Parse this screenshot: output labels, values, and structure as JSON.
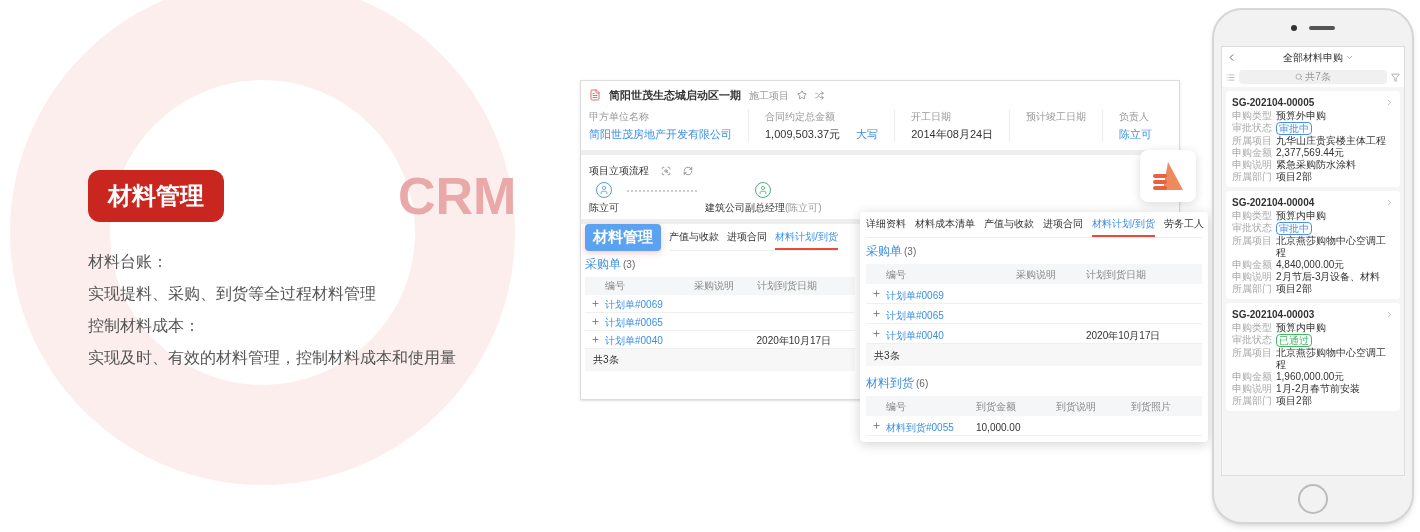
{
  "feature": {
    "watermark": "CRM",
    "title": "材料管理",
    "lines": [
      "材料台账：",
      "实现提料、采购、到货等全过程材料管理",
      "控制材料成本：",
      "实现及时、有效的材料管理，控制材料成本和使用量"
    ]
  },
  "project_window": {
    "title": "简阳世茂生态城启动区一期",
    "tag": "施工项目",
    "fields": [
      {
        "label": "甲方单位名称",
        "value": "简阳世茂房地产开发有限公司",
        "link": true
      },
      {
        "label": "合同约定总金额",
        "value": "1,009,503.37元",
        "link": false,
        "extra": "大写"
      },
      {
        "label": "开工日期",
        "value": "2014年08月24日",
        "link": false
      },
      {
        "label": "预计竣工日期"
      },
      {
        "label": "负责人",
        "value": "陈立可",
        "link": true
      }
    ],
    "process": {
      "title": "项目立项流程",
      "steps": [
        {
          "name": "陈立可",
          "color": "#5b9bd5"
        },
        {
          "name": "建筑公司副总经理",
          "note": "(陈立可)",
          "color": "#4caf7a"
        }
      ]
    },
    "badge": "材料管理",
    "tabs": [
      {
        "label": "产值与收款",
        "selected": false
      },
      {
        "label": "进项合同",
        "selected": false
      },
      {
        "label": "材料计划/到货",
        "selected": true
      }
    ],
    "table": {
      "title": "采购单",
      "count": "(3)",
      "columns": [
        "编号",
        "采购说明",
        "计划到货日期"
      ],
      "rows": [
        {
          "number": "计划单#0069"
        },
        {
          "number": "计划单#0065"
        },
        {
          "number": "计划单#0040",
          "date": "2020年10月17日"
        }
      ],
      "footer": "共3条"
    }
  },
  "detail_card": {
    "tabs": [
      {
        "label": "详细资料",
        "selected": false
      },
      {
        "label": "材料成本清单",
        "selected": false
      },
      {
        "label": "产值与收款",
        "selected": false
      },
      {
        "label": "进项合同",
        "selected": false
      },
      {
        "label": "材料计划/到货",
        "selected": true
      },
      {
        "label": "劳务工人",
        "selected": false
      }
    ],
    "purchase": {
      "title": "采购单",
      "count": "(3)",
      "columns": [
        "编号",
        "采购说明",
        "计划到货日期"
      ],
      "rows": [
        {
          "number": "计划单#0069"
        },
        {
          "number": "计划单#0065"
        },
        {
          "number": "计划单#0040",
          "date": "2020年10月17日"
        }
      ],
      "footer": "共3条"
    },
    "arrival": {
      "title": "材料到货",
      "count": "(6)",
      "columns": [
        "编号",
        "到货金额",
        "到货说明",
        "到货照片"
      ],
      "rows": [
        {
          "number": "材料到货#0055",
          "amount": "10,000.00"
        }
      ]
    }
  },
  "phone": {
    "title": "全部材料申购",
    "search": {
      "placeholder": "共7条"
    },
    "cards": [
      {
        "code": "SG-202104-00005",
        "fields": [
          {
            "label": "申购类型",
            "value": "预算外申购"
          },
          {
            "label": "审批状态",
            "value": "审批中",
            "kind": "status",
            "color": "#4a90e2"
          },
          {
            "label": "所属项目",
            "value": "九华山庄贵宾楼主体工程"
          },
          {
            "label": "申购金额",
            "value": "2,377,569.44元"
          },
          {
            "label": "申购说明",
            "value": "紧急采购防水涂料"
          },
          {
            "label": "所属部门",
            "value": "项目2部"
          }
        ]
      },
      {
        "code": "SG-202104-00004",
        "fields": [
          {
            "label": "申购类型",
            "value": "预算内申购"
          },
          {
            "label": "审批状态",
            "value": "审批中",
            "kind": "status",
            "color": "#4a90e2"
          },
          {
            "label": "所属项目",
            "value": "北京燕莎购物中心空调工程"
          },
          {
            "label": "申购金额",
            "value": "4,840,000.00元"
          },
          {
            "label": "申购说明",
            "value": "2月节后-3月设备、材料"
          },
          {
            "label": "所属部门",
            "value": "项目2部"
          }
        ]
      },
      {
        "code": "SG-202104-00003",
        "fields": [
          {
            "label": "申购类型",
            "value": "预算内申购"
          },
          {
            "label": "审批状态",
            "value": "已通过",
            "kind": "status",
            "color": "#43b565"
          },
          {
            "label": "所属项目",
            "value": "北京燕莎购物中心空调工程"
          },
          {
            "label": "申购金额",
            "value": "1,960,000.00元"
          },
          {
            "label": "申购说明",
            "value": "1月-2月春节前安装"
          },
          {
            "label": "所属部门",
            "value": "项目2部"
          }
        ]
      }
    ]
  }
}
